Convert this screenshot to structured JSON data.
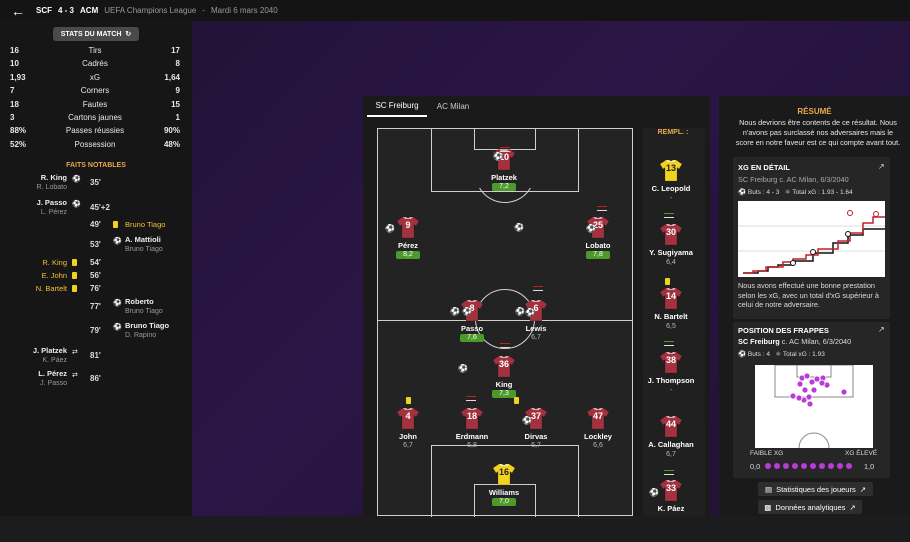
{
  "header": {
    "home_abbr": "SCF",
    "score": "4 - 3",
    "away_abbr": "ACM",
    "competition": "UEFA Champions League",
    "separator": "-",
    "date": "Mardi 6 mars 2040"
  },
  "stats": {
    "title": "STATS DU MATCH",
    "rows": [
      {
        "home": "16",
        "label": "Tirs",
        "away": "17"
      },
      {
        "home": "10",
        "label": "Cadrés",
        "away": "8"
      },
      {
        "home": "1,93",
        "label": "xG",
        "away": "1,64"
      },
      {
        "home": "7",
        "label": "Corners",
        "away": "9"
      },
      {
        "home": "18",
        "label": "Fautes",
        "away": "15"
      },
      {
        "home": "3",
        "label": "Cartons jaunes",
        "away": "1"
      },
      {
        "home": "88%",
        "label": "Passes réussies",
        "away": "90%"
      },
      {
        "home": "52%",
        "label": "Possession",
        "away": "48%"
      }
    ]
  },
  "faits": {
    "title": "FAITS NOTABLES",
    "events": [
      {
        "minute": "35'",
        "home_p": "R. King",
        "home_s": "R. Lobato",
        "away_p": "",
        "away_s": ""
      },
      {
        "minute": "45'+2",
        "home_p": "J. Passo",
        "home_s": "L. Pérez",
        "away_p": "",
        "away_s": ""
      },
      {
        "minute": "49'",
        "home_p": "",
        "home_s": "",
        "away_p": "Bruno Tiago",
        "away_s": ""
      },
      {
        "minute": "53'",
        "home_p": "",
        "home_s": "",
        "away_p": "A. Mattioli",
        "away_s": "Bruno Tiago"
      },
      {
        "minute": "54'",
        "home_p": "R. King",
        "home_s": "",
        "away_p": "",
        "away_s": ""
      },
      {
        "minute": "56'",
        "home_p": "E. John",
        "home_s": "",
        "away_p": "",
        "away_s": ""
      },
      {
        "minute": "76'",
        "home_p": "N. Bartelt",
        "home_s": "",
        "away_p": "",
        "away_s": ""
      },
      {
        "minute": "77'",
        "home_p": "",
        "home_s": "",
        "away_p": "Roberto",
        "away_s": "Bruno Tiago"
      },
      {
        "minute": "79'",
        "home_p": "",
        "home_s": "",
        "away_p": "Bruno Tiago",
        "away_s": "D. Rapino"
      },
      {
        "minute": "81'",
        "home_p": "J. Platzek",
        "home_s": "K. Páez",
        "away_p": "",
        "away_s": ""
      },
      {
        "minute": "86'",
        "home_p": "L. Pérez",
        "home_s": "J. Passo",
        "away_p": "",
        "away_s": ""
      }
    ]
  },
  "tabs": {
    "home": "SC Freiburg",
    "away": "AC Milan"
  },
  "players": [
    {
      "num": "10",
      "name": "Platzek",
      "rating": "7,2"
    },
    {
      "num": "9",
      "name": "Pérez",
      "rating": "8,2"
    },
    {
      "num": "25",
      "name": "Lobato",
      "rating": "7,8"
    },
    {
      "num": "8",
      "name": "Passo",
      "rating": "7,6"
    },
    {
      "num": "6",
      "name": "Lewis",
      "rating": "6,7"
    },
    {
      "num": "36",
      "name": "King",
      "rating": "7,3"
    },
    {
      "num": "4",
      "name": "John",
      "rating": "6,7"
    },
    {
      "num": "18",
      "name": "Erdmann",
      "rating": "6,8"
    },
    {
      "num": "37",
      "name": "Dirvas",
      "rating": "6,7"
    },
    {
      "num": "47",
      "name": "Lockley",
      "rating": "6,6"
    },
    {
      "num": "16",
      "name": "Williams",
      "rating": "7,0"
    }
  ],
  "subs": {
    "title": "REMPL. :",
    "list": [
      {
        "num": "13",
        "name": "C. Leopold",
        "rating": "-"
      },
      {
        "num": "30",
        "name": "Y. Sugiyama",
        "rating": "6,4"
      },
      {
        "num": "14",
        "name": "N. Bartelt",
        "rating": "6,5"
      },
      {
        "num": "38",
        "name": "J. Thompson",
        "rating": "-"
      },
      {
        "num": "44",
        "name": "A. Callaghan",
        "rating": "6,7"
      },
      {
        "num": "33",
        "name": "K. Páez",
        "rating": ""
      }
    ]
  },
  "resume": {
    "title": "RÉSUMÉ",
    "text": "Nous devrions être contents de ce résultat. Nous n'avons pas surclassé nos adversaires mais le score en notre faveur est ce qui compte avant tout."
  },
  "xg_card": {
    "title": "XG EN DÉTAIL",
    "subtitle": "SC Freiburg c. AC Milan, 6/3/2040",
    "goals": "Buts : 4 - 3",
    "total": "Total xG : 1.93 - 1.64",
    "summary": "Nous avons effectué une bonne prestation selon les xG, avec un total d'xG supérieur à celui de notre adversaire."
  },
  "shots_card": {
    "title": "POSITION DES FRAPPES",
    "team": "SC Freiburg",
    "subtitle": " c. AC Milan, 6/3/2040",
    "goals": "Buts : 4",
    "total": "Total xG : 1.93",
    "low": "FAIBLE XG",
    "high": "XG ÉLEVÉ",
    "min": "0,0",
    "max": "1,0"
  },
  "buttons": {
    "stats": "Statistiques des joueurs",
    "analytics": "Données analytiques"
  },
  "colors": {
    "accent": "#e8a94b",
    "home_shirt": "#a3323e",
    "gk_shirt": "#f1d21f",
    "rating_green": "#4c9a2a"
  }
}
